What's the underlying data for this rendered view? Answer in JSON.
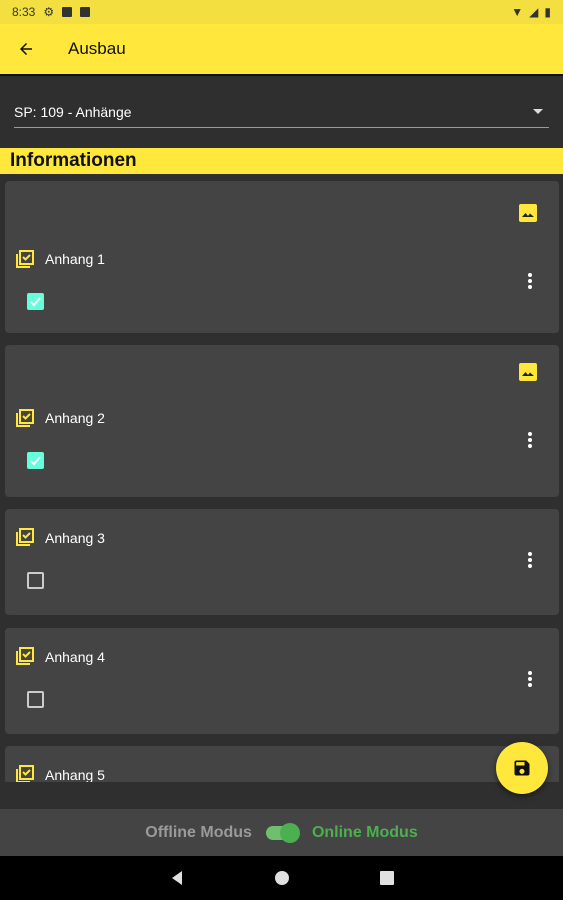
{
  "status": {
    "time": "8:33"
  },
  "appbar": {
    "title": "Ausbau"
  },
  "dropdown": {
    "selected": "SP: 109 - Anhänge"
  },
  "section": {
    "title": "Informationen"
  },
  "items": [
    {
      "label": "Anhang 1",
      "checked": true,
      "has_image": true
    },
    {
      "label": "Anhang 2",
      "checked": true,
      "has_image": true
    },
    {
      "label": "Anhang 3",
      "checked": false,
      "has_image": false
    },
    {
      "label": "Anhang 4",
      "checked": false,
      "has_image": false
    },
    {
      "label": "Anhang 5",
      "checked": false,
      "has_image": false
    }
  ],
  "footer": {
    "offline_label": "Offline Modus",
    "online_label": "Online Modus",
    "online_enabled": true
  },
  "colors": {
    "accent": "#ffe83b",
    "card": "#444444",
    "check": "#64ffda",
    "online": "#4caf50"
  }
}
